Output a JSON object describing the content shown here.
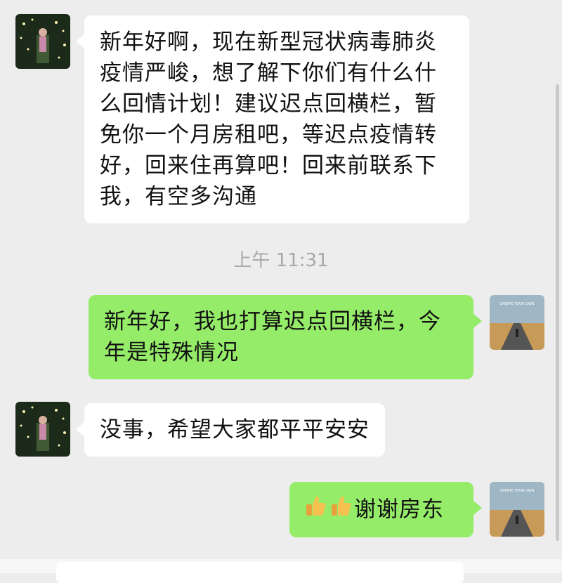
{
  "messages": [
    {
      "side": "left",
      "text": "新年好啊，现在新型冠状病毒肺炎疫情严峻，想了解下你们有什么什么回情计划！建议迟点回横栏，暂免你一个月房租吧，等迟点疫情转好，回来住再算吧！回来前联系下我，有空多沟通"
    },
    {
      "side": "right",
      "text": "新年好，我也打算迟点回横栏，今年是特殊情况"
    },
    {
      "side": "left",
      "text": "没事，希望大家都平平安安"
    },
    {
      "side": "right",
      "text": "谢谢房东",
      "emoji": [
        "thumbs-up",
        "thumbs-up"
      ]
    }
  ],
  "timestamp": "上午 11:31",
  "avatar_right_caption": "CREATE YOUR OWN"
}
